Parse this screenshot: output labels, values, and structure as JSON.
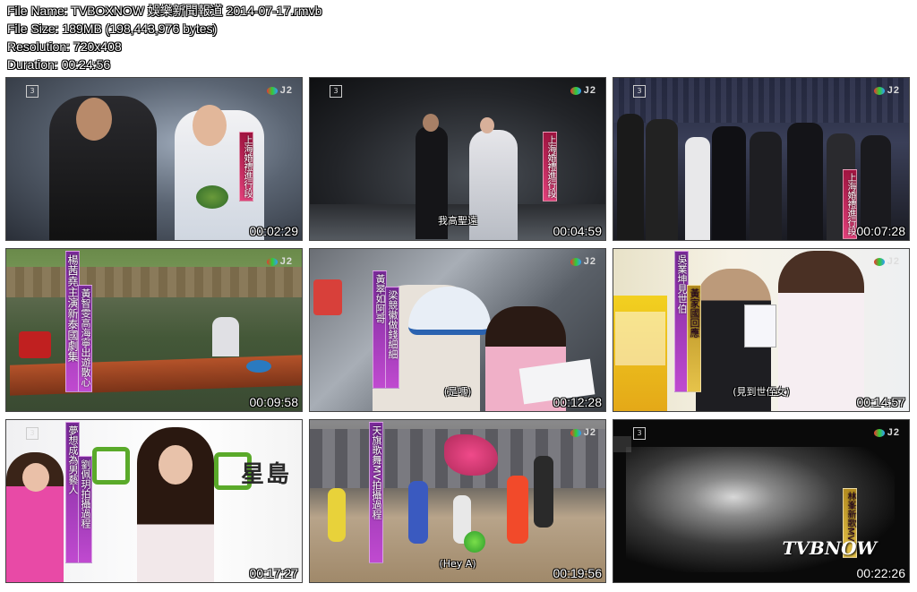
{
  "info": {
    "file_name": "File Name: TVBOXNOW 娛樂新聞報道 2014-07-17.rmvb",
    "file_size": "File Size: 189MB (198,443,976 bytes)",
    "resolution": "Resolution: 720x408",
    "duration": "Duration: 00:24:56"
  },
  "logo": {
    "network": "J2",
    "channel": "3"
  },
  "watermark": "TVBNOW",
  "thumbnails": [
    {
      "timestamp": "00:02:29",
      "subtitle": "",
      "banners": [
        "上海婚禮進行段"
      ]
    },
    {
      "timestamp": "00:04:59",
      "subtitle": "我高聖遠",
      "banners": [
        "上海婚禮進行段"
      ]
    },
    {
      "timestamp": "00:07:28",
      "subtitle": "",
      "banners": [
        "上海婚禮進行段"
      ]
    },
    {
      "timestamp": "00:09:58",
      "subtitle": "",
      "banners": [
        "楊茜堯主演新泰國劇集",
        "黃智雯高海寧出遊散心"
      ]
    },
    {
      "timestamp": "00:12:28",
      "subtitle": "(是嗎)",
      "banners": [
        "黃翠如阿哥",
        "梁競徽做錢細細"
      ]
    },
    {
      "timestamp": "00:14:57",
      "subtitle": "(見到世侄女)",
      "banners": [
        "吳業坤見世伯",
        "黃家國回應"
      ]
    },
    {
      "timestamp": "00:17:27",
      "subtitle": "",
      "banners": [
        "夢想成為男藝人",
        "劉佩玥拍攝過程"
      ],
      "sign": "星島"
    },
    {
      "timestamp": "00:19:56",
      "subtitle": "(Hey A)",
      "banners": [
        "天旗歌舞MV拍攝過程"
      ]
    },
    {
      "timestamp": "00:22:26",
      "subtitle": "",
      "banners": [
        "林峯新歌MV"
      ]
    }
  ]
}
